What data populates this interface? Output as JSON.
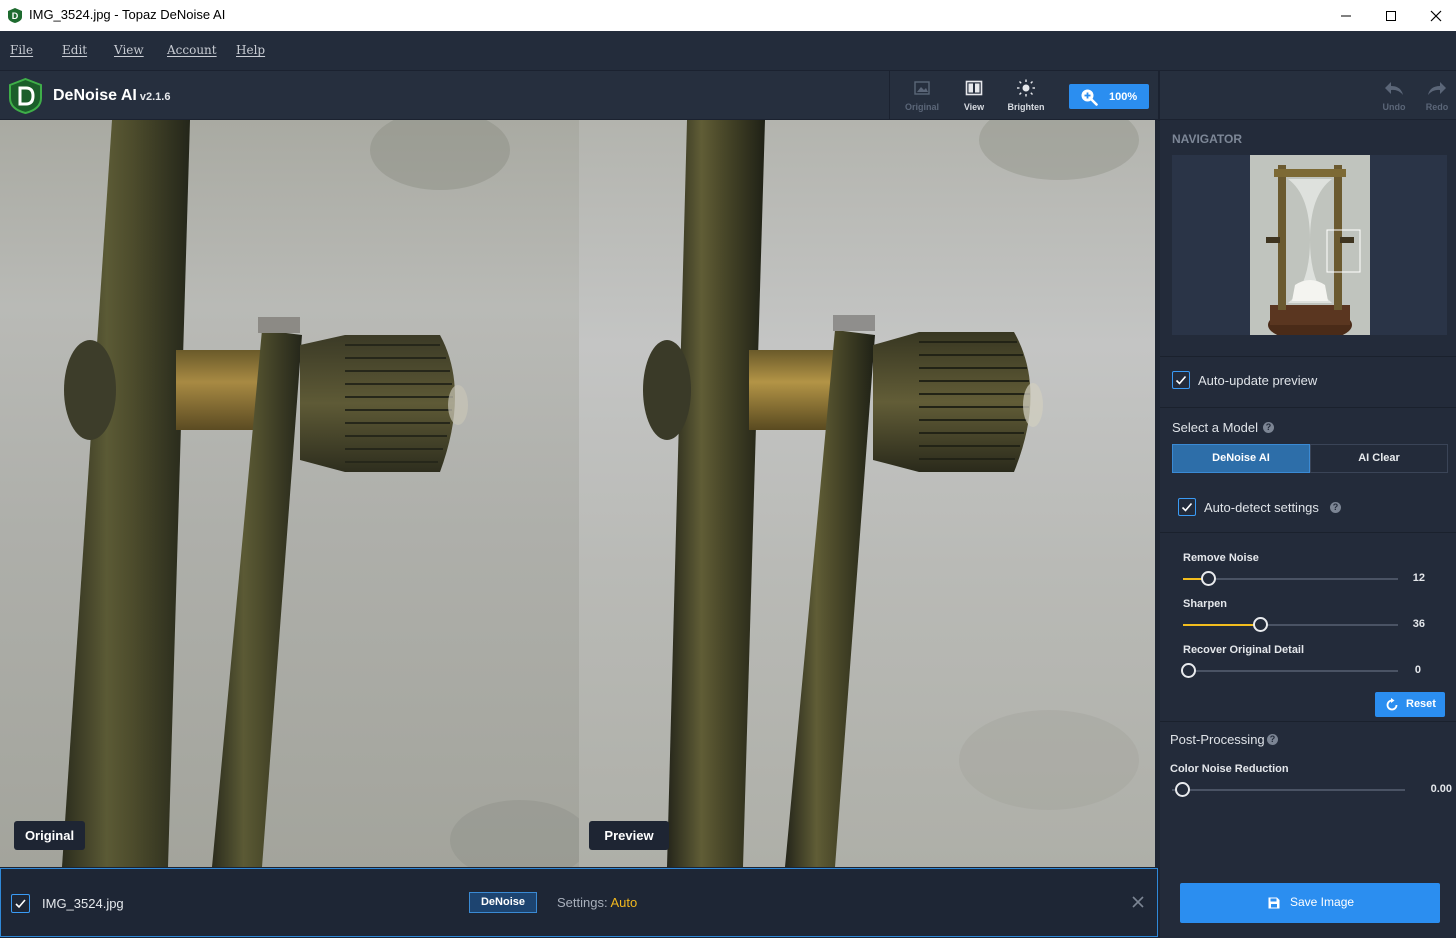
{
  "window": {
    "title": "IMG_3524.jpg - Topaz DeNoise AI",
    "controls": [
      "minimize-icon",
      "maximize-icon",
      "close-icon"
    ]
  },
  "menu": {
    "items": [
      {
        "label": "File"
      },
      {
        "label": "Edit"
      },
      {
        "label": "View"
      },
      {
        "label": "Account"
      },
      {
        "label": "Help"
      }
    ]
  },
  "toolbar": {
    "app_name": "DeNoise AI",
    "version": "v2.1.6",
    "original_label": "Original",
    "view_label": "View",
    "brighten_label": "Brighten",
    "zoom_label": "100%",
    "undo_label": "Undo",
    "redo_label": "Redo"
  },
  "canvas": {
    "original_tag": "Original",
    "preview_tag": "Preview"
  },
  "panel": {
    "navigator_title": "NAVIGATOR",
    "auto_update_label": "Auto-update preview",
    "auto_update_checked": true,
    "select_model_label": "Select a Model",
    "models": [
      {
        "label": "DeNoise AI",
        "selected": true
      },
      {
        "label": "AI Clear",
        "selected": false
      }
    ],
    "auto_detect_label": "Auto-detect settings",
    "auto_detect_checked": true,
    "sliders": [
      {
        "label": "Remove Noise",
        "value": "12",
        "fraction": 0.12
      },
      {
        "label": "Sharpen",
        "value": "36",
        "fraction": 0.36
      },
      {
        "label": "Recover Original Detail",
        "value": "0",
        "fraction": 0.0
      }
    ],
    "reset_label": "Reset",
    "post_processing_label": "Post-Processing",
    "color_noise": {
      "label": "Color Noise Reduction",
      "value": "0.00",
      "fraction": 0.0
    }
  },
  "bottom": {
    "file_name": "IMG_3524.jpg",
    "file_checked": true,
    "badge": "DeNoise",
    "settings_label": "Settings:",
    "settings_value": "Auto",
    "save_label": "Save Image"
  },
  "colors": {
    "accent": "#2b8ef0",
    "slider_fill": "#f2bd1e",
    "settings_value": "#f2b81e"
  }
}
